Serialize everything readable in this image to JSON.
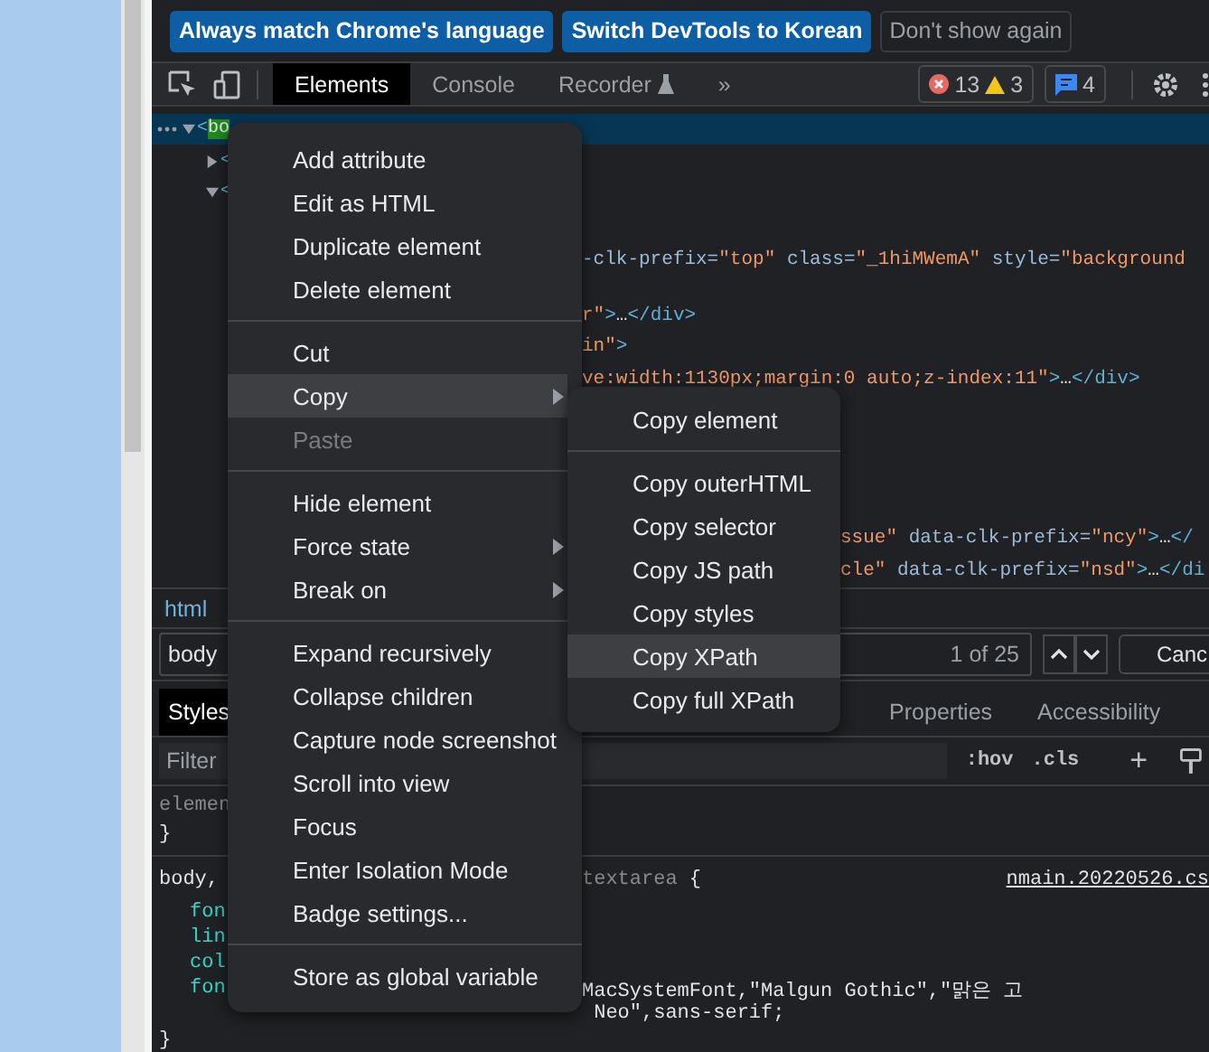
{
  "infobar": {
    "buttons": [
      {
        "label": "Always match Chrome's language",
        "kind": "primary"
      },
      {
        "label": "Switch DevTools to Korean",
        "kind": "primary"
      },
      {
        "label": "Don't show again",
        "kind": "secondary"
      }
    ]
  },
  "toolbar": {
    "tabs": [
      {
        "label": "Elements",
        "selected": true
      },
      {
        "label": "Console",
        "selected": false
      },
      {
        "label": "Recorder",
        "selected": false
      }
    ],
    "more": "»",
    "errors": "13",
    "warnings": "3",
    "messages": "4"
  },
  "elements_tree": {
    "rows": [
      {
        "kind": "node",
        "selected": true,
        "expanded": true,
        "left": [
          {
            "kind": "tag",
            "text": "<"
          },
          {
            "kind": "match",
            "text": "bo"
          }
        ]
      },
      {
        "kind": "node",
        "selected": false,
        "expanded": false,
        "left": [
          {
            "kind": "tag",
            "text": "<"
          }
        ]
      },
      {
        "kind": "node",
        "selected": false,
        "expanded": true,
        "left": [
          {
            "kind": "tag",
            "text": "<"
          }
        ]
      },
      {
        "kind": "fragment",
        "selected": false,
        "right": [
          {
            "kind": "attr",
            "text": "-clk-prefix="
          },
          {
            "kind": "value",
            "text": "\"top\""
          },
          {
            "kind": "attr",
            "text": " class="
          },
          {
            "kind": "value",
            "text": "\"_1hiMWemA\""
          },
          {
            "kind": "attr",
            "text": " style="
          },
          {
            "kind": "value",
            "text": "\"background"
          }
        ]
      },
      {
        "kind": "fragment",
        "selected": false,
        "right": [
          {
            "kind": "value",
            "text": "r\""
          },
          {
            "kind": "tag",
            "text": ">"
          },
          {
            "kind": "text",
            "text": "…"
          },
          {
            "kind": "tag",
            "text": "</div>"
          }
        ]
      },
      {
        "kind": "fragment",
        "selected": false,
        "right": [
          {
            "kind": "value",
            "text": "in\""
          },
          {
            "kind": "tag",
            "text": ">"
          }
        ]
      },
      {
        "kind": "fragment",
        "selected": false,
        "right": [
          {
            "kind": "value",
            "text": "ve:width:1130px;margin:0 auto;z-index:11\""
          },
          {
            "kind": "tag",
            "text": ">"
          },
          {
            "kind": "text",
            "text": "…"
          },
          {
            "kind": "tag",
            "text": "</div>"
          }
        ]
      },
      {
        "kind": "fragment",
        "selected": false,
        "right": [
          {
            "kind": "value",
            "text": "ssue\""
          },
          {
            "kind": "attr",
            "text": " data-clk-prefix="
          },
          {
            "kind": "value",
            "text": "\"ncy\""
          },
          {
            "kind": "tag",
            "text": ">"
          },
          {
            "kind": "text",
            "text": "…"
          },
          {
            "kind": "tag",
            "text": "</"
          }
        ]
      },
      {
        "kind": "fragment",
        "selected": false,
        "right": [
          {
            "kind": "value",
            "text": "cle\""
          },
          {
            "kind": "attr",
            "text": " data-clk-prefix="
          },
          {
            "kind": "value",
            "text": "\"nsd\""
          },
          {
            "kind": "tag",
            "text": ">"
          },
          {
            "kind": "text",
            "text": "…"
          },
          {
            "kind": "tag",
            "text": "</di"
          }
        ]
      }
    ]
  },
  "breadcrumb": "html",
  "search": {
    "value": "body",
    "count": "1 of 25",
    "cancel": "Canc"
  },
  "styles_tabs": [
    {
      "label": "Styles",
      "selected": true
    },
    {
      "label": "Properties",
      "selected": false
    },
    {
      "label": "Accessibility",
      "selected": false
    }
  ],
  "filter": {
    "placeholder": "Filter",
    "hov": ":hov",
    "cls": ".cls",
    "add": "+"
  },
  "styles_code": [
    {
      "left": [
        {
          "kind": "dim",
          "text": "elemen"
        }
      ]
    },
    {
      "left": [
        {
          "kind": "punct",
          "text": "}"
        }
      ]
    },
    {
      "left": [
        {
          "kind": "selector",
          "text": "body,"
        }
      ],
      "right": [
        {
          "kind": "dim",
          "text": "textarea"
        },
        {
          "kind": "punct",
          "text": " {"
        }
      ],
      "source": "nmain.20220526.cs"
    },
    {
      "left": [
        {
          "kind": "prop",
          "text": "fon"
        }
      ]
    },
    {
      "left": [
        {
          "kind": "prop",
          "text": "lin"
        }
      ]
    },
    {
      "left": [
        {
          "kind": "prop",
          "text": "col"
        }
      ]
    },
    {
      "left": [
        {
          "kind": "prop",
          "text": "fon"
        }
      ],
      "right": [
        {
          "kind": "punct",
          "text": "MacSystemFont,\"Malgun Gothic\",\"맑은 고"
        }
      ]
    },
    {
      "right": [
        {
          "kind": "punct",
          "text": " Neo\",sans-serif;"
        }
      ]
    },
    {
      "left": [
        {
          "kind": "punct",
          "text": "}"
        }
      ]
    }
  ],
  "context_menu": {
    "items": [
      {
        "kind": "item",
        "label": "Add attribute",
        "highlighted": false,
        "disabled": false,
        "submenu": false
      },
      {
        "kind": "item",
        "label": "Edit as HTML",
        "highlighted": false,
        "disabled": false,
        "submenu": false
      },
      {
        "kind": "item",
        "label": "Duplicate element",
        "highlighted": false,
        "disabled": false,
        "submenu": false
      },
      {
        "kind": "item",
        "label": "Delete element",
        "highlighted": false,
        "disabled": false,
        "submenu": false
      },
      {
        "kind": "separator"
      },
      {
        "kind": "item",
        "label": "Cut",
        "highlighted": false,
        "disabled": false,
        "submenu": false
      },
      {
        "kind": "item",
        "label": "Copy",
        "highlighted": true,
        "disabled": false,
        "submenu": true
      },
      {
        "kind": "item",
        "label": "Paste",
        "highlighted": false,
        "disabled": true,
        "submenu": false
      },
      {
        "kind": "separator"
      },
      {
        "kind": "item",
        "label": "Hide element",
        "highlighted": false,
        "disabled": false,
        "submenu": false
      },
      {
        "kind": "item",
        "label": "Force state",
        "highlighted": false,
        "disabled": false,
        "submenu": true
      },
      {
        "kind": "item",
        "label": "Break on",
        "highlighted": false,
        "disabled": false,
        "submenu": true
      },
      {
        "kind": "separator"
      },
      {
        "kind": "item",
        "label": "Expand recursively",
        "highlighted": false,
        "disabled": false,
        "submenu": false
      },
      {
        "kind": "item",
        "label": "Collapse children",
        "highlighted": false,
        "disabled": false,
        "submenu": false
      },
      {
        "kind": "item",
        "label": "Capture node screenshot",
        "highlighted": false,
        "disabled": false,
        "submenu": false
      },
      {
        "kind": "item",
        "label": "Scroll into view",
        "highlighted": false,
        "disabled": false,
        "submenu": false
      },
      {
        "kind": "item",
        "label": "Focus",
        "highlighted": false,
        "disabled": false,
        "submenu": false
      },
      {
        "kind": "item",
        "label": "Enter Isolation Mode",
        "highlighted": false,
        "disabled": false,
        "submenu": false
      },
      {
        "kind": "item",
        "label": "Badge settings...",
        "highlighted": false,
        "disabled": false,
        "submenu": false
      },
      {
        "kind": "separator"
      },
      {
        "kind": "item",
        "label": "Store as global variable",
        "highlighted": false,
        "disabled": false,
        "submenu": false
      }
    ]
  },
  "copy_submenu": {
    "items": [
      {
        "kind": "item",
        "label": "Copy element",
        "highlighted": false,
        "disabled": false,
        "submenu": false
      },
      {
        "kind": "separator"
      },
      {
        "kind": "item",
        "label": "Copy outerHTML",
        "highlighted": false,
        "disabled": false,
        "submenu": false
      },
      {
        "kind": "item",
        "label": "Copy selector",
        "highlighted": false,
        "disabled": false,
        "submenu": false
      },
      {
        "kind": "item",
        "label": "Copy JS path",
        "highlighted": false,
        "disabled": false,
        "submenu": false
      },
      {
        "kind": "item",
        "label": "Copy styles",
        "highlighted": false,
        "disabled": false,
        "submenu": false
      },
      {
        "kind": "item",
        "label": "Copy XPath",
        "highlighted": true,
        "disabled": false,
        "submenu": false
      },
      {
        "kind": "item",
        "label": "Copy full XPath",
        "highlighted": false,
        "disabled": false,
        "submenu": false
      }
    ]
  }
}
